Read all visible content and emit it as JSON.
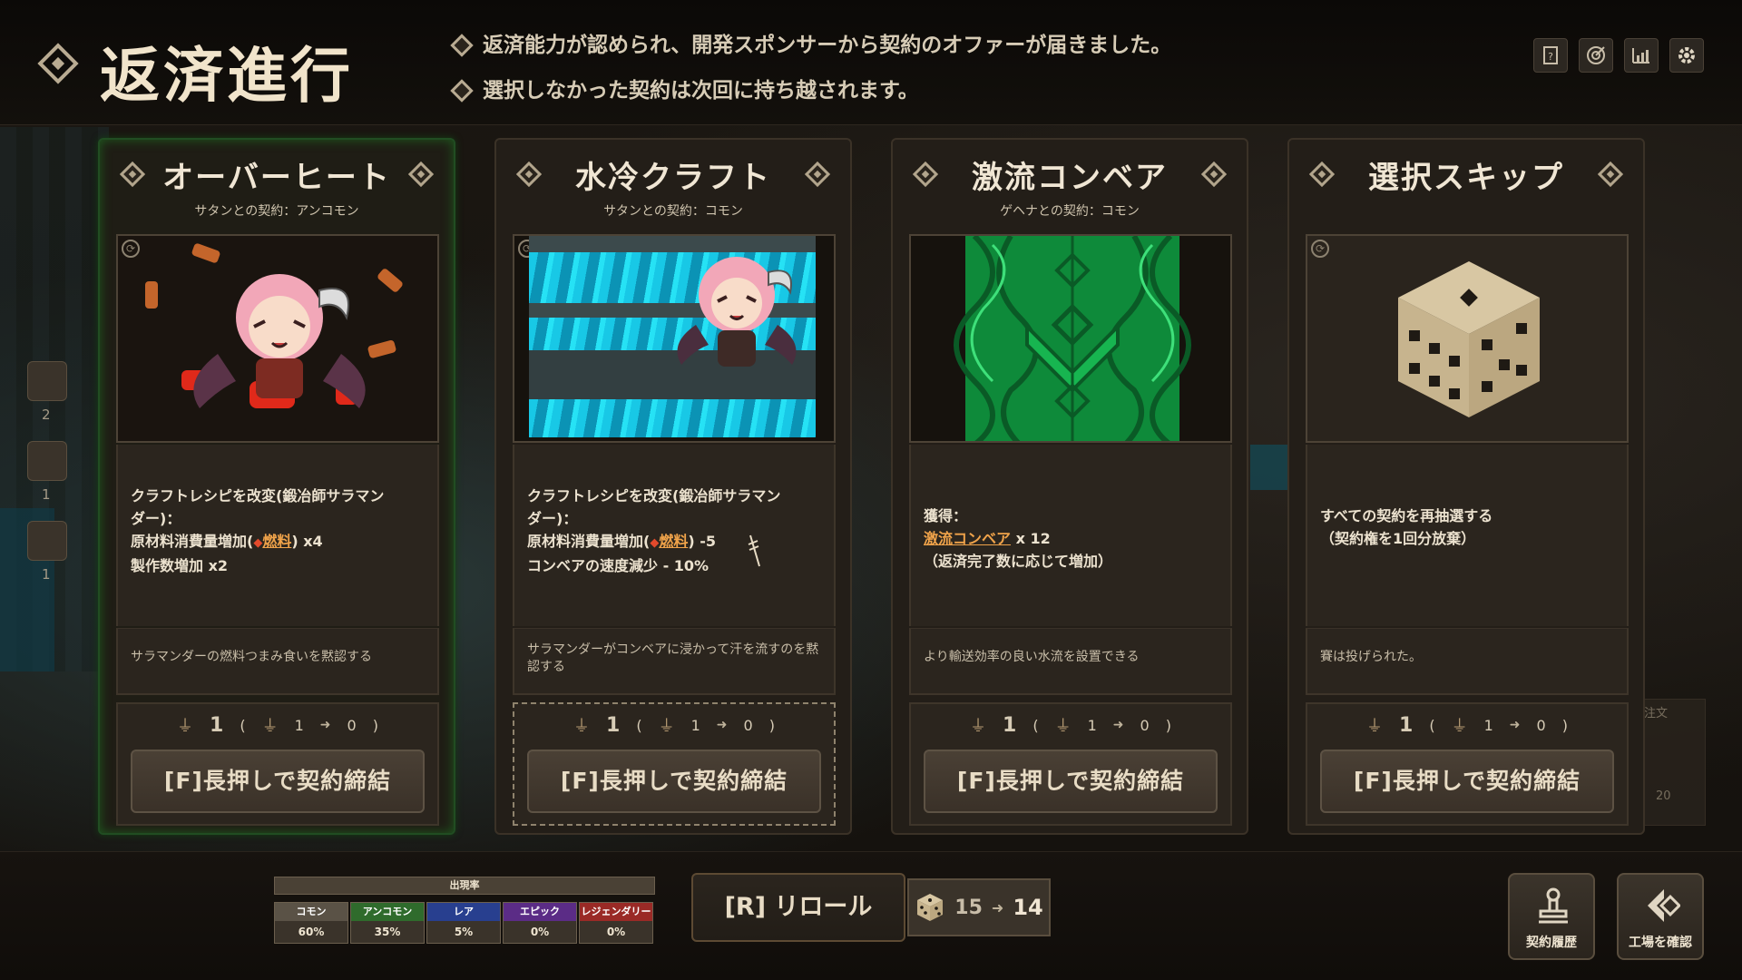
{
  "header": {
    "title": "返済進行",
    "messages": [
      "返済能力が認められ、開発スポンサーから契約のオファーが届きました。",
      "選択しなかった契約は次回に持ち越されます。"
    ],
    "icons": [
      "help-icon",
      "target-icon",
      "stats-icon",
      "settings-icon"
    ]
  },
  "cards": [
    {
      "title": "オーバーヒート",
      "subtitle": "サタンとの契約：アンコモン",
      "desc": {
        "line1": "クラフトレシピを改変(鍛冶師サラマン",
        "line2": "ダー)：",
        "line3_pre": "原材料消費量増加(",
        "line3_link": "燃料",
        "line3_post": ") x4",
        "line4": "製作数増加 x2"
      },
      "flavor": "サラマンダーの燃料つまみ食いを黙認する",
      "cost": {
        "main": "1",
        "a": "1",
        "b": "0"
      },
      "button": "[F]長押しで契約締結",
      "selected": true
    },
    {
      "title": "水冷クラフト",
      "subtitle": "サタンとの契約：コモン",
      "desc": {
        "line1": "クラフトレシピを改変(鍛冶師サラマン",
        "line2": "ダー)：",
        "line3_pre": "原材料消費量増加(",
        "line3_link": "燃料",
        "line3_post": ") -5",
        "line4": "コンベアの速度減少 - 10%"
      },
      "flavor": "サラマンダーがコンベアに浸かって汗を流すのを黙認する",
      "cost": {
        "main": "1",
        "a": "1",
        "b": "0"
      },
      "button": "[F]長押しで契約締結",
      "focused": true
    },
    {
      "title": "激流コンベア",
      "subtitle": "ゲヘナとの契約：コモン",
      "desc": {
        "line1": "獲得：",
        "line2_link": "激流コンベア",
        "line2_post": " x 12",
        "line3": "（返済完了数に応じて増加）"
      },
      "flavor": "より輸送効率の良い水流を設置できる",
      "cost": {
        "main": "1",
        "a": "1",
        "b": "0"
      },
      "button": "[F]長押しで契約締結"
    },
    {
      "title": "選択スキップ",
      "subtitle": "",
      "desc": {
        "line1": "すべての契約を再抽選する",
        "line2": "（契約権を1回分放棄）"
      },
      "flavor": "賽は投げられた。",
      "cost": {
        "main": "1",
        "a": "1",
        "b": "0"
      },
      "button": "[F]長押しで契約締結"
    }
  ],
  "rarity": {
    "title": "出現率",
    "items": [
      {
        "label": "コモン",
        "value": "60%",
        "color": "#5a5246"
      },
      {
        "label": "アンコモン",
        "value": "35%",
        "color": "#2f6b2c"
      },
      {
        "label": "レア",
        "value": "5%",
        "color": "#283f8f"
      },
      {
        "label": "エピック",
        "value": "0%",
        "color": "#5b2c86"
      },
      {
        "label": "レジェンダリー",
        "value": "0%",
        "color": "#9a2a26"
      }
    ]
  },
  "reroll": {
    "label": "[R]  リロール",
    "current": "15",
    "after": "14"
  },
  "corner": {
    "history": "契約履歴",
    "factory": "工場を確認"
  },
  "side": {
    "counts": [
      "2",
      "1",
      "1"
    ]
  },
  "ghost": {
    "label": "の注文",
    "count": "20"
  }
}
